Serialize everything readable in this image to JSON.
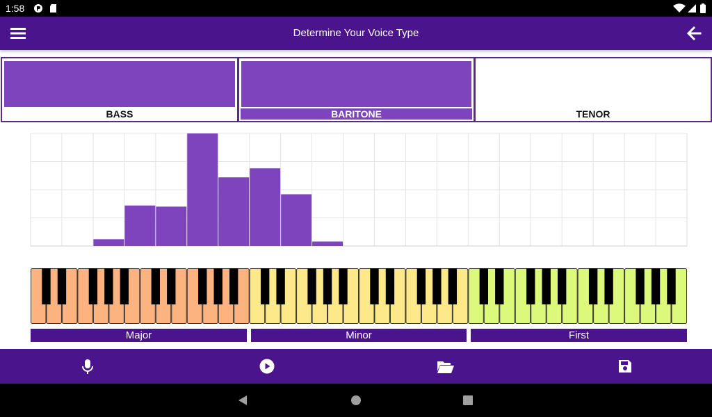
{
  "status_bar": {
    "time": "1:58"
  },
  "app_bar": {
    "title": "Determine Your Voice Type"
  },
  "voice_types": [
    {
      "label": "BASS",
      "level": 1.0,
      "selected": false
    },
    {
      "label": "BARITONE",
      "level": 1.0,
      "selected": true
    },
    {
      "label": "TENOR",
      "level": 0.0,
      "selected": false
    }
  ],
  "chart_data": {
    "type": "bar",
    "values": [
      0,
      0,
      6,
      36,
      35,
      100,
      61,
      69,
      46,
      4,
      0,
      0,
      0,
      0,
      0,
      0,
      0,
      0,
      0,
      0,
      0
    ],
    "ylim": [
      0,
      100
    ],
    "grid": true,
    "bar_color": "#7e44bd"
  },
  "keyboard": {
    "sections": [
      {
        "label": "Major",
        "color": "#fdb380"
      },
      {
        "label": "Minor",
        "color": "#fde98a"
      },
      {
        "label": "First",
        "color": "#dcf97b"
      }
    ]
  },
  "bottom_bar": {
    "icons": [
      "microphone-icon",
      "play-icon",
      "folder-open-icon",
      "save-icon"
    ]
  },
  "colors": {
    "primary": "#4a148c",
    "accent": "#7e44bd"
  }
}
